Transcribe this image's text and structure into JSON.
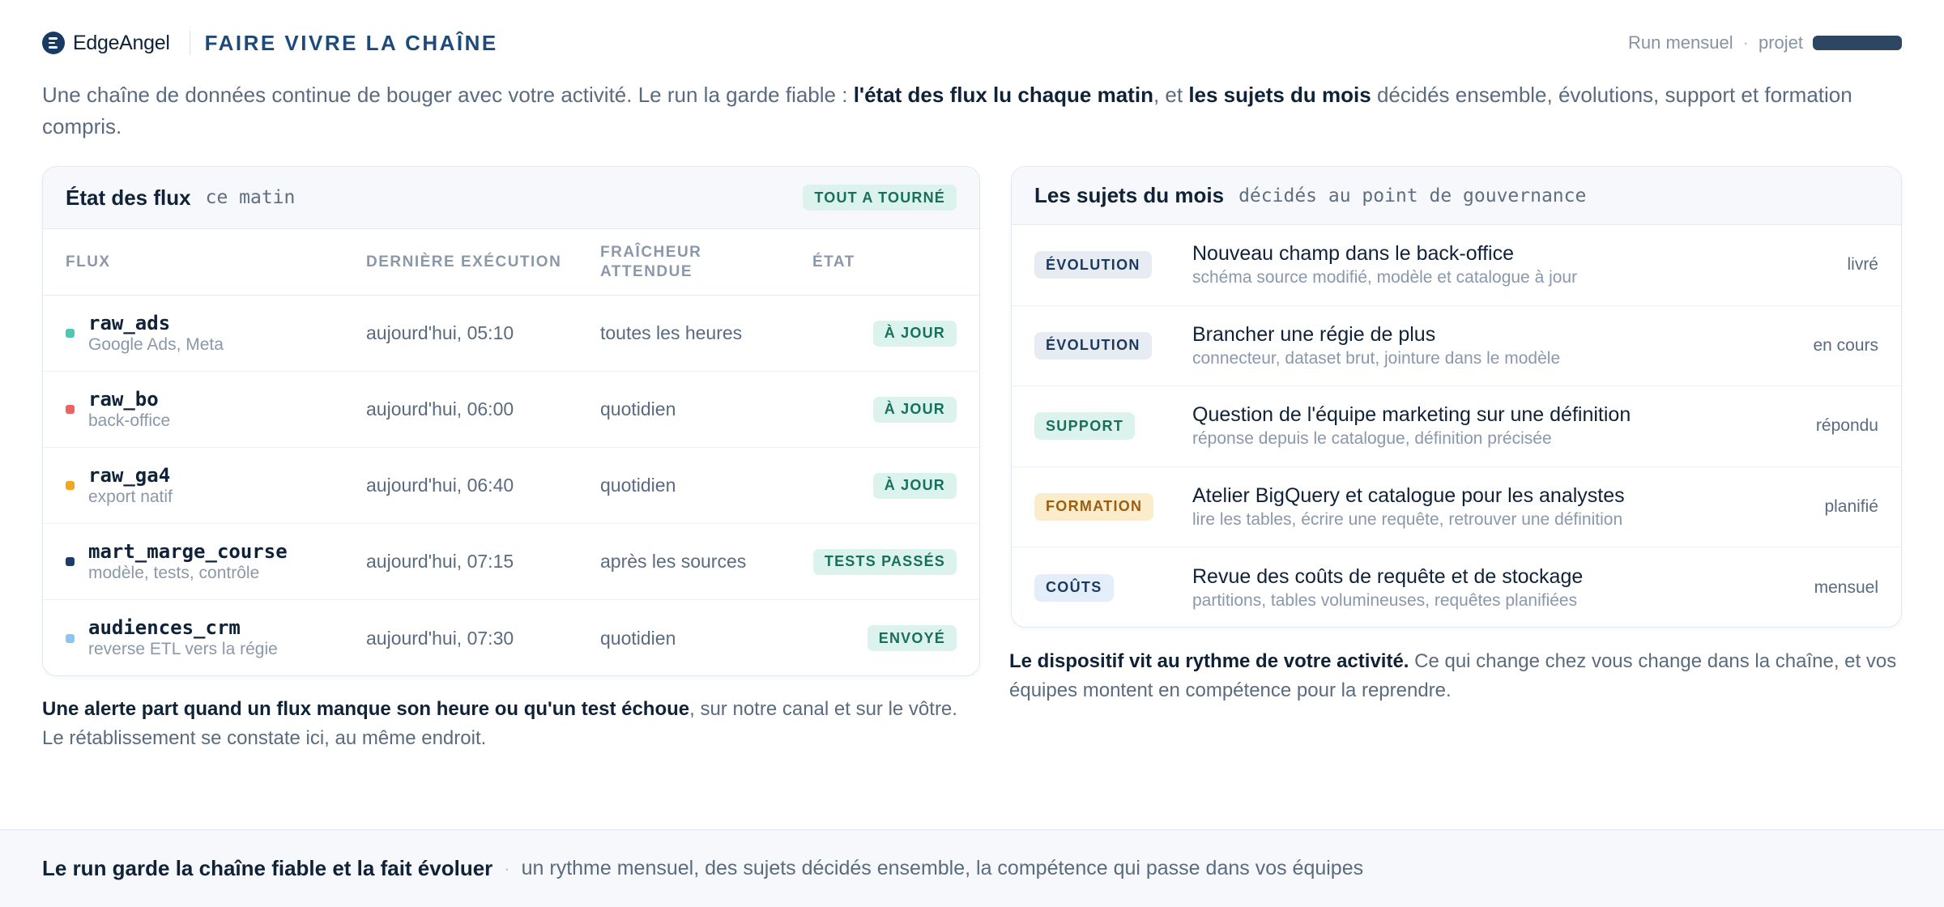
{
  "header": {
    "logo_text": "EdgeAngel",
    "logo_icon": "edgeangel-logo-icon",
    "title": "FAIRE VIVRE LA CHAÎNE",
    "run_label": "Run mensuel",
    "separator": "·",
    "project_label": "projet",
    "project_value_redacted": true
  },
  "intro": {
    "part1": "Une chaîne de données continue de bouger avec votre activité. Le run la garde fiable : ",
    "bold1": "l'état des flux lu chaque matin",
    "part2": ", et ",
    "bold2": "les sujets du mois",
    "part3": " décidés ensemble, évolutions, support et formation compris."
  },
  "flux_card": {
    "title": "État des flux",
    "subtitle": "ce matin",
    "badge": "TOUT A TOURNÉ",
    "columns": [
      "FLUX",
      "DERNIÈRE EXÉCUTION",
      "FRAÎCHEUR ATTENDUE",
      "ÉTAT"
    ],
    "rows": [
      {
        "name": "raw_ads",
        "desc": "Google Ads, Meta",
        "dot_color": "#4fc7b5",
        "last_run": "aujourd'hui, 05:10",
        "freshness": "toutes les heures",
        "state": "À JOUR"
      },
      {
        "name": "raw_bo",
        "desc": "back-office",
        "dot_color": "#ee6161",
        "last_run": "aujourd'hui, 06:00",
        "freshness": "quotidien",
        "state": "À JOUR"
      },
      {
        "name": "raw_ga4",
        "desc": "export natif",
        "dot_color": "#f3a622",
        "last_run": "aujourd'hui, 06:40",
        "freshness": "quotidien",
        "state": "À JOUR"
      },
      {
        "name": "mart_marge_course",
        "desc": "modèle, tests, contrôle",
        "dot_color": "#1c3d63",
        "last_run": "aujourd'hui, 07:15",
        "freshness": "après les sources",
        "state": "TESTS PASSÉS"
      },
      {
        "name": "audiences_crm",
        "desc": "reverse ETL vers la régie",
        "dot_color": "#8ec4f2",
        "last_run": "aujourd'hui, 07:30",
        "freshness": "quotidien",
        "state": "ENVOYÉ"
      }
    ]
  },
  "flux_note": {
    "bold": "Une alerte part quand un flux manque son heure ou qu'un test échoue",
    "text": ", sur notre canal et sur le vôtre. Le rétablissement se constate ici, au même endroit."
  },
  "sujets_card": {
    "title": "Les sujets du mois",
    "subtitle": "décidés au point de gouvernance",
    "items": [
      {
        "tag": "ÉVOLUTION",
        "tag_class": "tag-evolution",
        "title": "Nouveau champ dans le back-office",
        "desc": "schéma source modifié, modèle et catalogue à jour",
        "status": "livré"
      },
      {
        "tag": "ÉVOLUTION",
        "tag_class": "tag-evolution",
        "title": "Brancher une régie de plus",
        "desc": "connecteur, dataset brut, jointure dans le modèle",
        "status": "en cours"
      },
      {
        "tag": "SUPPORT",
        "tag_class": "tag-support",
        "title": "Question de l'équipe marketing sur une définition",
        "desc": "réponse depuis le catalogue, définition précisée",
        "status": "répondu"
      },
      {
        "tag": "FORMATION",
        "tag_class": "tag-formation",
        "title": "Atelier BigQuery et catalogue pour les analystes",
        "desc": "lire les tables, écrire une requête, retrouver une définition",
        "status": "planifié"
      },
      {
        "tag": "COÛTS",
        "tag_class": "tag-couts",
        "title": "Revue des coûts de requête et de stockage",
        "desc": "partitions, tables volumineuses, requêtes planifiées",
        "status": "mensuel"
      }
    ]
  },
  "sujets_note": {
    "bold": "Le dispositif vit au rythme de votre activité.",
    "text": " Ce qui change chez vous change dans la chaîne, et vos équipes montent en compétence pour la reprendre."
  },
  "footer": {
    "title": "Le run garde la chaîne fiable et la fait évoluer",
    "separator": "·",
    "text": "un rythme mensuel, des sujets décidés ensemble, la compétence qui passe dans vos équipes"
  }
}
